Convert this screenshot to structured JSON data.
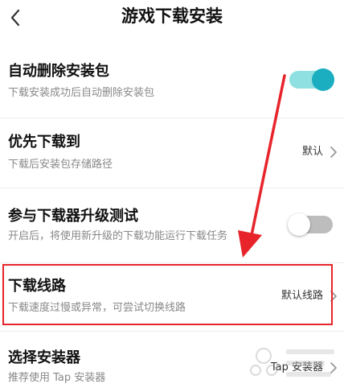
{
  "header": {
    "title": "游戏下载安装",
    "back_icon": "chevron-left-icon"
  },
  "settings": [
    {
      "title": "自动删除安装包",
      "subtitle": "下载安装成功后自动删除安装包",
      "control": "toggle",
      "enabled": true
    },
    {
      "title": "优先下载到",
      "subtitle": "下载后安装包存储路径",
      "control": "value",
      "value": "默认"
    },
    {
      "title": "参与下载器升级测试",
      "subtitle": "开启后，将使用新升级的下载功能运行下载任务",
      "control": "toggle",
      "enabled": false
    },
    {
      "title": "下载线路",
      "subtitle": "下载速度过慢或异常，可尝试切换线路",
      "control": "value",
      "value": "默认线路"
    },
    {
      "title": "选择安装器",
      "subtitle": "推荐使用 Tap 安装器",
      "control": "value",
      "value": "Tap 安装器"
    }
  ],
  "colors": {
    "toggle_on_track": "#8fe0e0",
    "toggle_on_knob": "#1aaec0",
    "toggle_off_track": "#bdbdbd",
    "annotation_red": "#e8242b"
  }
}
